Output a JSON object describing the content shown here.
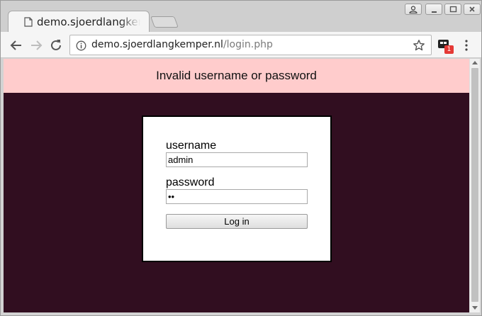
{
  "browser": {
    "tab_title": "demo.sjoerdlangkemper.nl/login.php",
    "url_host": "demo.sjoerdlangkemper.nl",
    "url_path": "/login.php",
    "extension_badge": "1",
    "icons": [
      "page-icon",
      "profile-icon",
      "minimize-icon",
      "maximize-icon",
      "close-icon",
      "back-arrow-icon",
      "forward-arrow-icon",
      "reload-icon",
      "info-icon",
      "star-icon",
      "extension-icon",
      "menu-icon"
    ]
  },
  "page": {
    "error_message": "Invalid username or password",
    "username_label": "username",
    "username_value": "admin",
    "password_label": "password",
    "password_value": "••",
    "login_label": "Log in"
  },
  "colors": {
    "error_banner_bg": "#ffcccc",
    "page_bg": "#310e20",
    "login_box_bg": "#ffffff"
  }
}
